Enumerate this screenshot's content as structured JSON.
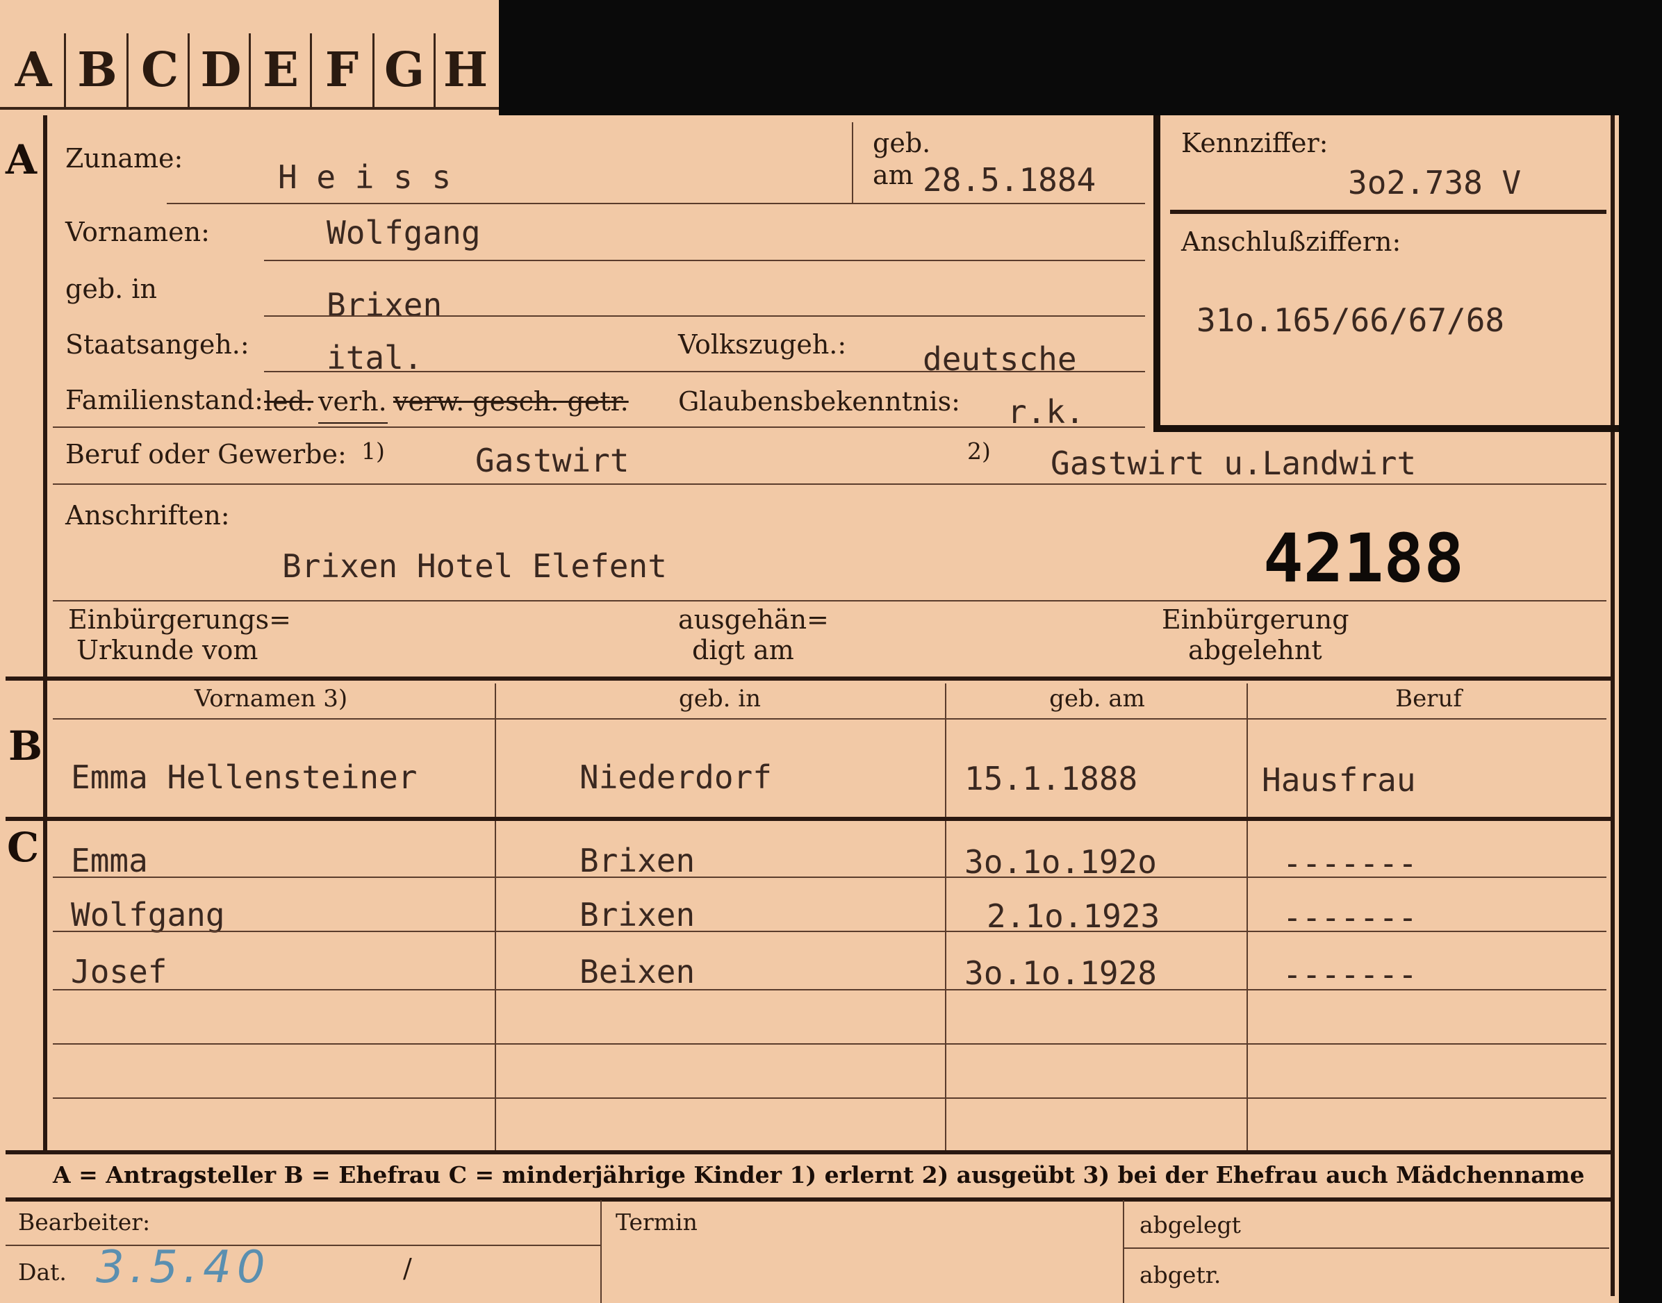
{
  "tabs": [
    "A",
    "B",
    "C",
    "D",
    "E",
    "F",
    "G",
    "H"
  ],
  "section_a": {
    "marker": "A",
    "zuname_label": "Zuname:",
    "zuname": "H e i s s",
    "geb_label": "geb.",
    "geb_am_label": "am",
    "geb_am": "28.5.1884",
    "vornamen_label": "Vornamen:",
    "vornamen": "Wolfgang",
    "geb_in_label": "geb. in",
    "geb_in": "Brixen",
    "staatsangeh_label": "Staatsangeh.:",
    "staatsangeh": "ital.",
    "volkszugeh_label": "Volkszugeh.:",
    "volkszugeh": "deutsche",
    "familienstand_label": "Familienstand:",
    "familienstand_struck1": "led.",
    "familienstand_selected": "verh.",
    "familienstand_struck2": "verw. gesch. getr.",
    "glaubens_label": "Glaubensbekenntnis:",
    "glaubens": "r.k.",
    "beruf_label": "Beruf oder Gewerbe:",
    "beruf_note1": "1)",
    "beruf1": "Gastwirt",
    "beruf_note2": "2)",
    "beruf2": "Gastwirt u.Landwirt",
    "anschriften_label": "Anschriften:",
    "anschrift": "Brixen  Hotel Elefent",
    "number": "42188",
    "einbuerg_label_1": "Einbürgerungs=",
    "einbuerg_label_2": "Urkunde vom",
    "ausgehaen_1": "ausgehän=",
    "ausgehaen_2": "digt am",
    "einbuerg_status_1": "Einbürgerung",
    "einbuerg_status_2": "abgelehnt"
  },
  "kennziffer": {
    "label": "Kennziffer:",
    "value": "3o2.738   V",
    "anschluss_label": "Anschlußziffern:",
    "anschluss_value": "31o.165/66/67/68"
  },
  "table": {
    "headers": [
      "Vornamen 3)",
      "geb. in",
      "geb. am",
      "Beruf"
    ],
    "b_marker": "B",
    "b_row": [
      "Emma Hellensteiner",
      "Niederdorf",
      "15.1.1888",
      "Hausfrau"
    ],
    "c_marker": "C",
    "c_rows": [
      [
        "Emma",
        "Brixen",
        "3o.1o.192o",
        "-------"
      ],
      [
        "Wolfgang",
        "Brixen",
        "2.1o.1923",
        "-------"
      ],
      [
        "Josef",
        "Beixen",
        "3o.1o.1928",
        "-------"
      ]
    ]
  },
  "legend": "A = Antragsteller   B = Ehefrau   C = minderjährige Kinder   1) erlernt   2) ausgeübt   3) bei der Ehefrau auch Mädchenname",
  "footer": {
    "bearbeiter_label": "Bearbeiter:",
    "dat_label": "Dat.",
    "dat_value": "3.5.40",
    "slash": "/",
    "termin_label": "Termin",
    "abgelegt_label": "abgelegt",
    "abgetr_label": "abgetr."
  }
}
